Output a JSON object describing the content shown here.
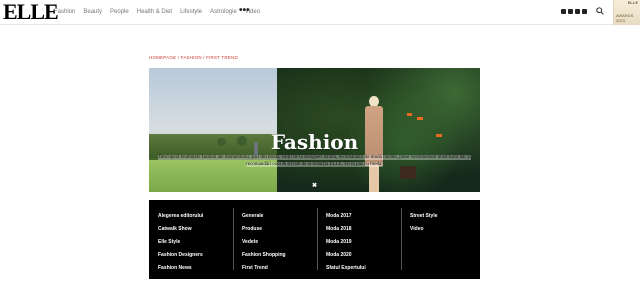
{
  "header": {
    "logo": "ELLE",
    "nav": [
      "Fashion",
      "Beauty",
      "People",
      "Health & Diet",
      "Lifestyle",
      "Astrologie",
      "Video"
    ],
    "more": "•••",
    "social_icons": [
      "facebook-icon",
      "pinterest-icon",
      "instagram-icon",
      "youtube-icon"
    ],
    "promo": {
      "top": "ELLE",
      "bottom": "AWARDS",
      "year": "2023"
    }
  },
  "breadcrumb": "HOMEPAGE / FASHION / FIRST TREND",
  "hero": {
    "title": "Fashion",
    "description": "Descoperă tendințele fashion ale momentului, ştiri din modă, ediții de la designeri străini, recomandări de modă inedite, piese vestimentare must-have dar și recomandări cool & stylish de la redacția ELLE. Fii în pas cu moda!",
    "close": "✖"
  },
  "menu": {
    "columns": [
      [
        "Alegerea editorului",
        "Catwalk Show",
        "Elle Style",
        "Fashion Designers",
        "Fashion News"
      ],
      [
        "Generale",
        "Produse",
        "Vedete",
        "Fashion Shopping",
        "First Trend"
      ],
      [
        "Moda 2017",
        "Moda 2018",
        "Moda 2019",
        "Moda 2020",
        "Sfatul Expertului"
      ],
      [
        "Street Style",
        "Video"
      ]
    ]
  },
  "colors": {
    "accent": "#c53a2f",
    "menu_bg": "#000000"
  }
}
